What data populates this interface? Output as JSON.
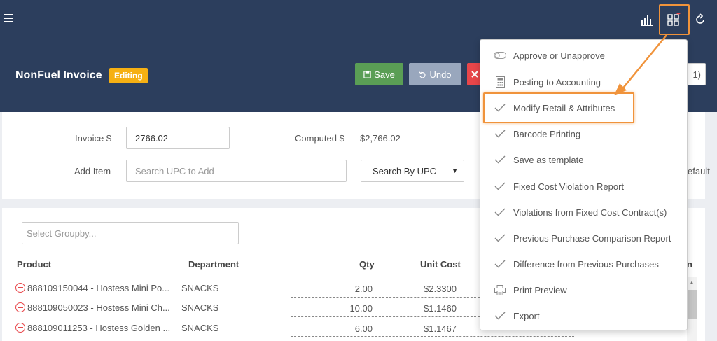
{
  "header": {
    "title": "NonFuel Invoice",
    "status_badge": "Editing",
    "save_label": "Save",
    "undo_label": "Undo",
    "partial_button_text": "1)"
  },
  "form": {
    "invoice_label": "Invoice $",
    "invoice_value": "2766.02",
    "computed_label": "Computed $",
    "computed_value": "$2,766.02",
    "add_item_label": "Add Item",
    "search_placeholder": "Search UPC to Add",
    "search_by_value": "Search By UPC",
    "right_partial_text": "efault"
  },
  "grid": {
    "groupby_placeholder": "Select Groupby...",
    "columns": [
      "Product",
      "Department",
      "Qty",
      "Unit Cost"
    ],
    "right_partial_header": "n",
    "rows": [
      {
        "product": "888109150044 - Hostess Mini Po...",
        "department": "SNACKS",
        "qty": "2.00",
        "unit_cost": "$2.3300"
      },
      {
        "product": "888109050023 - Hostess Mini Ch...",
        "department": "SNACKS",
        "qty": "10.00",
        "unit_cost": "$1.1460"
      },
      {
        "product": "888109011253 - Hostess Golden ...",
        "department": "SNACKS",
        "qty": "6.00",
        "unit_cost": "$1.1467"
      }
    ]
  },
  "menu": {
    "items": [
      {
        "label": "Approve or Unapprove",
        "icon": "toggle-icon"
      },
      {
        "label": "Posting to Accounting",
        "icon": "calculator-icon"
      },
      {
        "label": "Modify Retail & Attributes",
        "icon": "check-icon"
      },
      {
        "label": "Barcode Printing",
        "icon": "check-icon"
      },
      {
        "label": "Save as template",
        "icon": "check-icon"
      },
      {
        "label": "Fixed Cost Violation Report",
        "icon": "check-icon"
      },
      {
        "label": "Violations from Fixed Cost Contract(s)",
        "icon": "check-icon"
      },
      {
        "label": "Previous Purchase Comparison Report",
        "icon": "check-icon"
      },
      {
        "label": "Difference from Previous Purchases",
        "icon": "check-icon"
      },
      {
        "label": "Print Preview",
        "icon": "printer-icon"
      },
      {
        "label": "Export",
        "icon": "check-icon"
      }
    ]
  },
  "colors": {
    "header_bg": "#2c3e5d",
    "save": "#5a9e55",
    "undo": "#99a7bd",
    "delete": "#e8464a",
    "badge": "#f6b013",
    "highlight": "#f0933b"
  }
}
